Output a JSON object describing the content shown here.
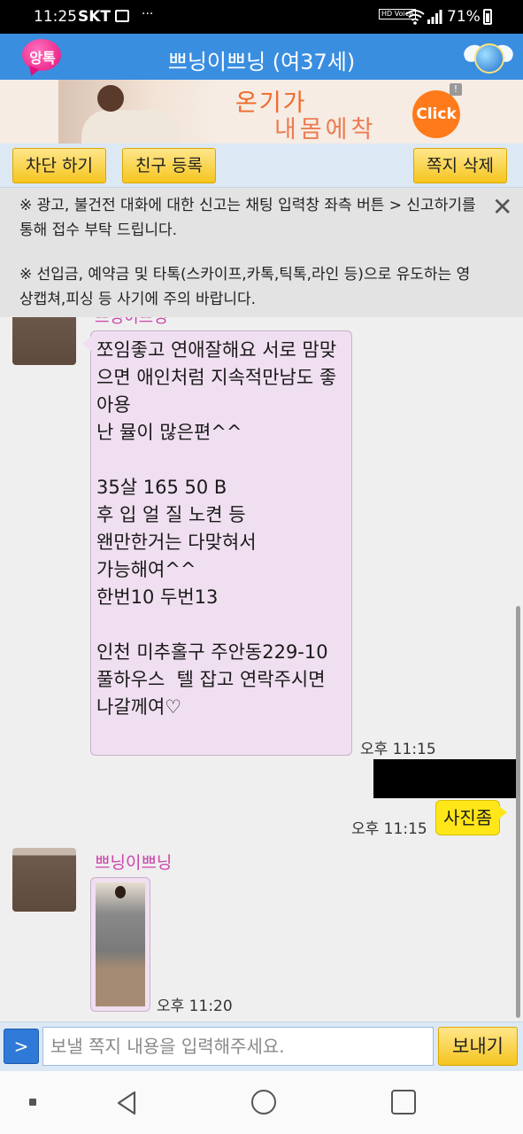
{
  "status_bar": {
    "time": "11:25",
    "carrier": "SKT",
    "more": "···",
    "hd_voice": "HD Voice",
    "battery": "71%"
  },
  "app": {
    "logo_text": "앙톡",
    "title": "쁘닝이쁘닝 (여37세)"
  },
  "ad": {
    "line1": "온기가",
    "line2": "내몸에착",
    "click": "Click",
    "info": "!"
  },
  "toolbar": {
    "block": "차단 하기",
    "add_friend": "친구 등록",
    "delete": "쪽지 삭제"
  },
  "notice": {
    "line1": "※ 광고, 불건전 대화에 대한 신고는 채팅 입력창 좌측 버튼 > 신고하기를 통해 접수 부탁 드립니다.",
    "line2": "※ 선입금, 예약금 및 타톡(스카이프,카톡,틱톡,라인 등)으로 유도하는 영상캡쳐,피싱 등 사기에 주의 바랍니다.",
    "close": "✕"
  },
  "chat": {
    "cut_sender": "쁘닝이쁘닝",
    "msg1": "쪼임좋고 연애잘해요 서로 맘맞으면 애인처럼 지속적만남도 좋아용\n난 뮬이 많은편^^\n\n35살 165 50 B\n후 입 얼 질 노켠 등\n왠만한거는 다맞혀서\n가능해여^^\n한번10 두번13\n\n인천 미추홀구 주안동229-10\n풀하우스  텔 잡고 연락주시면\n나갈께여♡",
    "msg1_time": "오후 11:15",
    "out_time": "오후 11:15",
    "out_msg": "사진좀",
    "sender": "쁘닝이쁘닝",
    "photo_time": "오후 11:20"
  },
  "input": {
    "menu": ">",
    "placeholder": "보낼 쪽지 내용을 입력해주세요.",
    "send": "보내기"
  },
  "colors": {
    "header": "#3a8ee0",
    "button": "#f5c51f",
    "bubble_in": "#f0dff0",
    "bubble_out": "#ffe619",
    "sender_name": "#cc44aa"
  }
}
